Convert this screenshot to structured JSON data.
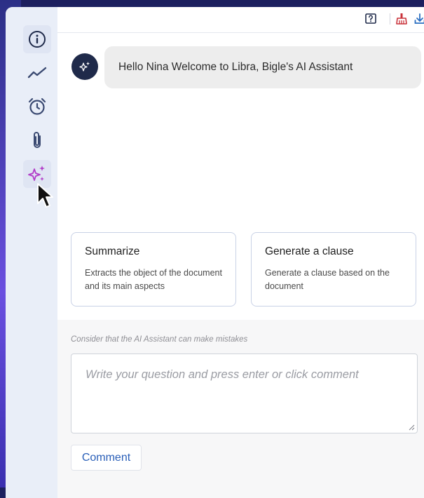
{
  "colors": {
    "accent_blue": "#2a5fb8",
    "sparkle_magenta": "#b13bc8",
    "navy": "#1f2a4a",
    "icon_red": "#c9323a",
    "icon_blue": "#2a6ec1"
  },
  "sidebar": {
    "items": [
      {
        "icon": "info-icon",
        "label": ""
      },
      {
        "icon": "trend-line-icon",
        "label": ""
      },
      {
        "icon": "alarm-clock-icon",
        "label": ""
      },
      {
        "icon": "paperclip-icon",
        "label": ""
      },
      {
        "icon": "sparkle-ai-icon",
        "label": "",
        "active": true
      }
    ]
  },
  "toolbar": {
    "icons": [
      "help-box-icon",
      "clear-brush-icon",
      "download-icon"
    ]
  },
  "chat": {
    "greeting": "Hello Nina Welcome to Libra, Bigle's AI Assistant"
  },
  "suggestions": [
    {
      "title": "Summarize",
      "description": "Extracts the object of the document and its main aspects"
    },
    {
      "title": "Generate a clause",
      "description": "Generate a clause based on the document"
    }
  ],
  "composer": {
    "disclaimer": "Consider that the AI Assistant can make mistakes",
    "placeholder": "Write your question and press enter or click comment",
    "button_label": "Comment"
  }
}
